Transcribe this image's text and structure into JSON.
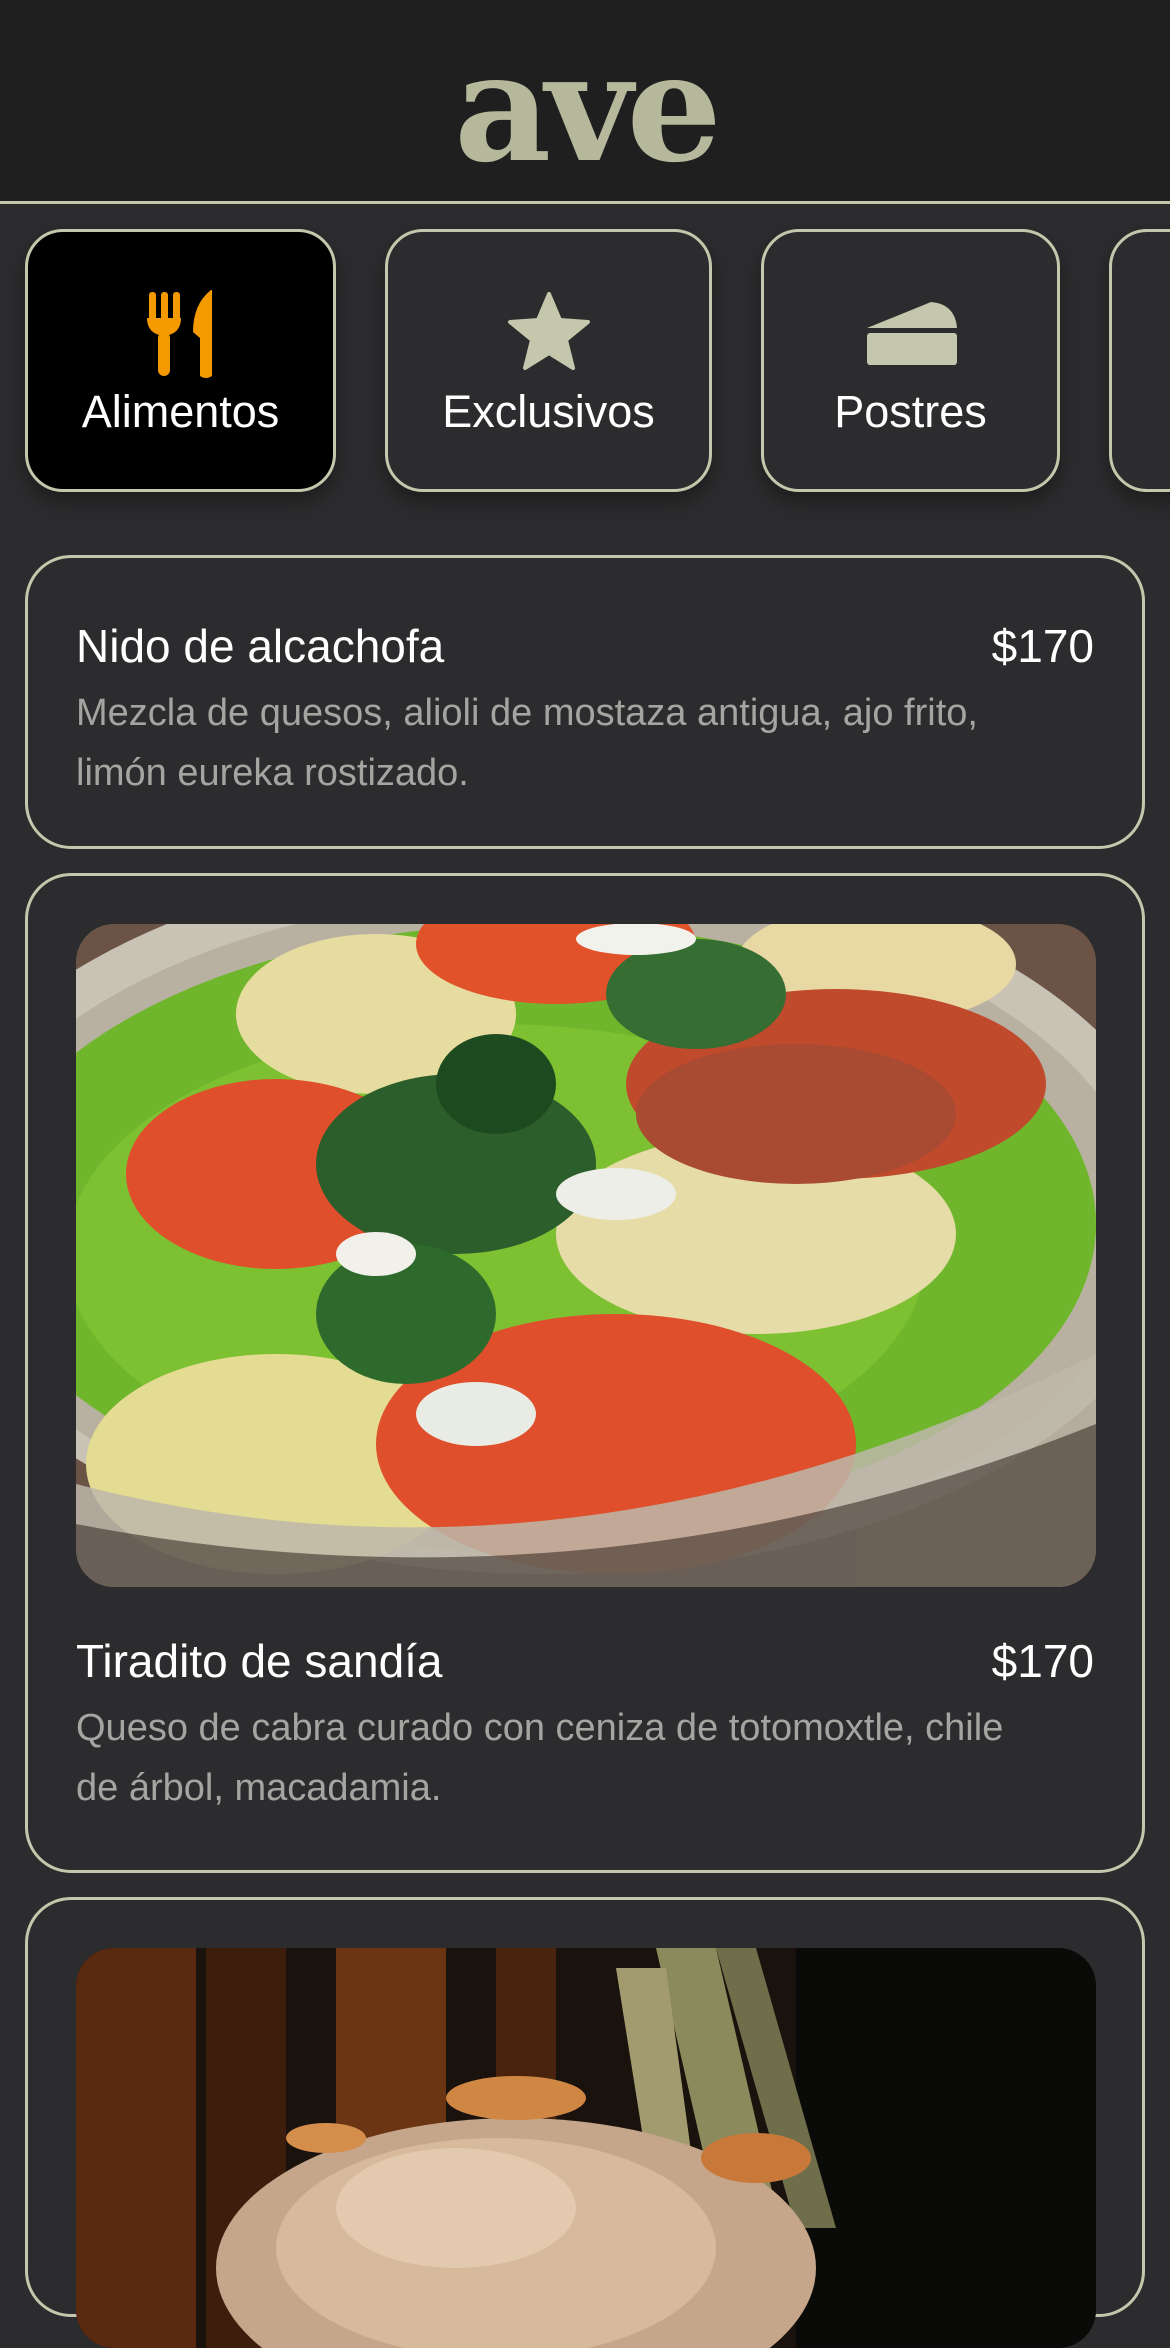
{
  "header": {
    "logo_text": "ave",
    "logo_icon": "ave-wordmark-logo"
  },
  "categories": [
    {
      "label": "Alimentos",
      "icon": "fork-knife-icon",
      "active": true
    },
    {
      "label": "Exclusivos",
      "icon": "star-icon",
      "active": false
    },
    {
      "label": "Postres",
      "icon": "cake-slice-icon",
      "active": false
    },
    {
      "label": "",
      "icon": "",
      "active": false
    }
  ],
  "menu_items": [
    {
      "name": "Nido de alcachofa",
      "price": "$170",
      "description": "Mezcla de quesos, alioli de mostaza antigua, ajo frito, limón eureka rostizado.",
      "has_photo": false
    },
    {
      "name": "Tiradito de sandía",
      "price": "$170",
      "description": "Queso de cabra curado con ceniza de totomoxtle, chile de árbol, macadamia.",
      "has_photo": true,
      "photo": "watermelon-tiradito-dish-photo"
    },
    {
      "name": "",
      "price": "",
      "description": "",
      "has_photo": true,
      "photo": "roasted-artichoke-dish-photo"
    }
  ],
  "colors": {
    "header_bg": "#1f1f1f",
    "page_bg": "#2c2c2e",
    "border": "#c5c7ad",
    "logo": "#b5b89a",
    "accent_icon": "#f29a00",
    "icon_muted": "#c5c7ad",
    "text_primary": "#ffffff",
    "text_secondary": "#a4a4a0",
    "active_tab_bg": "#000000"
  }
}
